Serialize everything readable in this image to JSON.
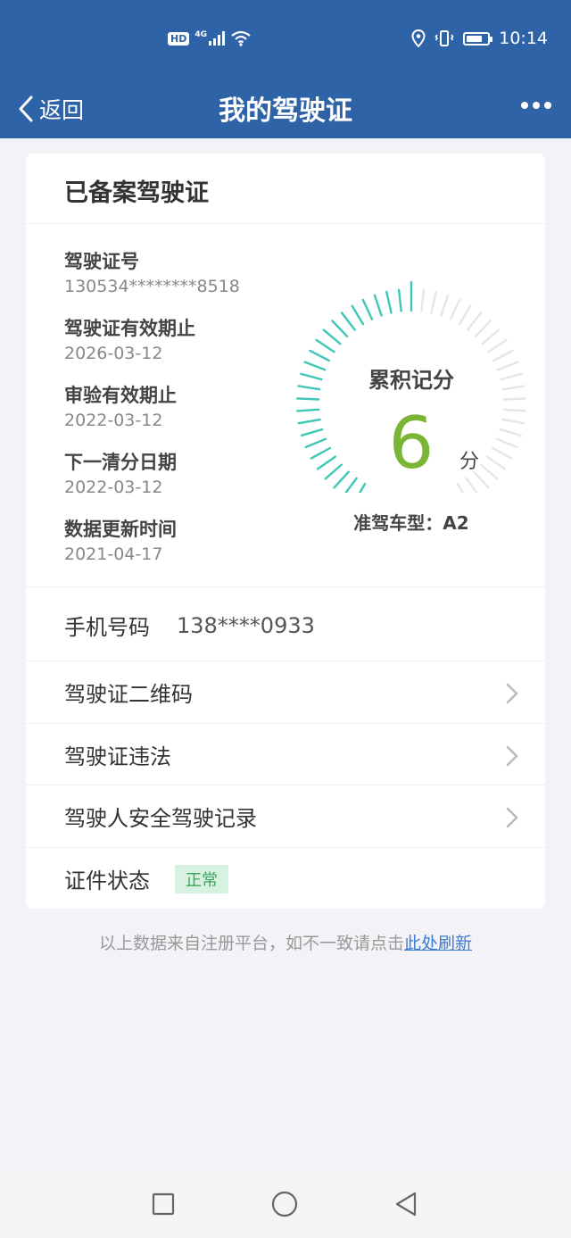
{
  "status_bar": {
    "hd": "HD",
    "network": "4G",
    "time": "10:14",
    "icons": [
      "signal-icon",
      "wifi-icon",
      "location-icon",
      "vibrate-icon",
      "battery-icon"
    ],
    "battery_level": 0.75
  },
  "nav": {
    "back_label": "返回",
    "title": "我的驾驶证",
    "more_icon": "more-icon"
  },
  "card": {
    "title": "已备案驾驶证",
    "info": [
      {
        "label": "驾驶证号",
        "value": "130534********8518"
      },
      {
        "label": "驾驶证有效期止",
        "value": "2026-03-12"
      },
      {
        "label": "审验有效期止",
        "value": "2022-03-12"
      },
      {
        "label": "下一清分日期",
        "value": "2022-03-12"
      },
      {
        "label": "数据更新时间",
        "value": "2021-04-17"
      }
    ],
    "gauge": {
      "title": "累积记分",
      "score": "6",
      "unit": "分",
      "score_value": 6,
      "max_value": 12,
      "vehicle_label": "准驾车型：",
      "vehicle_type": "A2"
    },
    "phone": {
      "label": "手机号码",
      "value": "138****0933"
    },
    "links": [
      {
        "label": "驾驶证二维码"
      },
      {
        "label": "驾驶证违法"
      },
      {
        "label": "驾驶人安全驾驶记录"
      }
    ],
    "status": {
      "label": "证件状态",
      "badge": "正常"
    }
  },
  "footnote": {
    "text": "以上数据来自注册平台，如不一致请点击",
    "link": "此处刷新"
  },
  "colors": {
    "header_bg": "#2f63a8",
    "page_bg": "#f2f2f7",
    "score_green": "#7ab536",
    "tick_teal": "#3ec7b5",
    "badge_bg": "#d8f2e1",
    "badge_text": "#3aa55a",
    "link_blue": "#3b7bd4"
  }
}
